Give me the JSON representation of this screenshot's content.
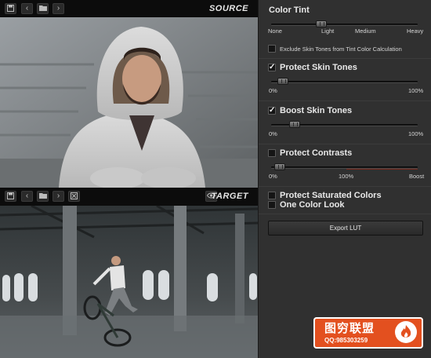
{
  "viewer": {
    "source_label": "SOURCE",
    "target_label": "TARGET"
  },
  "panel": {
    "color_tint": {
      "title": "Color Tint",
      "labels": [
        "Light",
        "None",
        "Medium",
        "Heavy"
      ],
      "value": 0.34
    },
    "exclude_skin": {
      "checked": false,
      "label": "Exclude Skin Tones from Tint Color Calculation"
    },
    "protect_skin": {
      "checked": true,
      "label": "Protect Skin Tones",
      "min_label": "0%",
      "max_label": "100%",
      "value": 0.08
    },
    "boost_skin": {
      "checked": true,
      "label": "Boost Skin Tones",
      "min_label": "0%",
      "max_label": "100%",
      "value": 0.16
    },
    "protect_contrasts": {
      "checked": false,
      "label": "Protect Contrasts",
      "min_label": "0%",
      "mid_label": "100%",
      "max_label": "Boost",
      "value": 0.06
    },
    "protect_saturated": {
      "checked": false,
      "label": "Protect Saturated Colors"
    },
    "one_color_look": {
      "checked": false,
      "label": "One Color Look"
    },
    "export_label": "Export LUT"
  },
  "watermark": {
    "title": "图穷联盟",
    "contact": "QQ:985303259"
  },
  "colors": {
    "panel_bg": "#303030",
    "viewer_bar": "#0c0c0c",
    "accent_red": "#7a2a1e",
    "watermark_bg": "#e3501f"
  }
}
